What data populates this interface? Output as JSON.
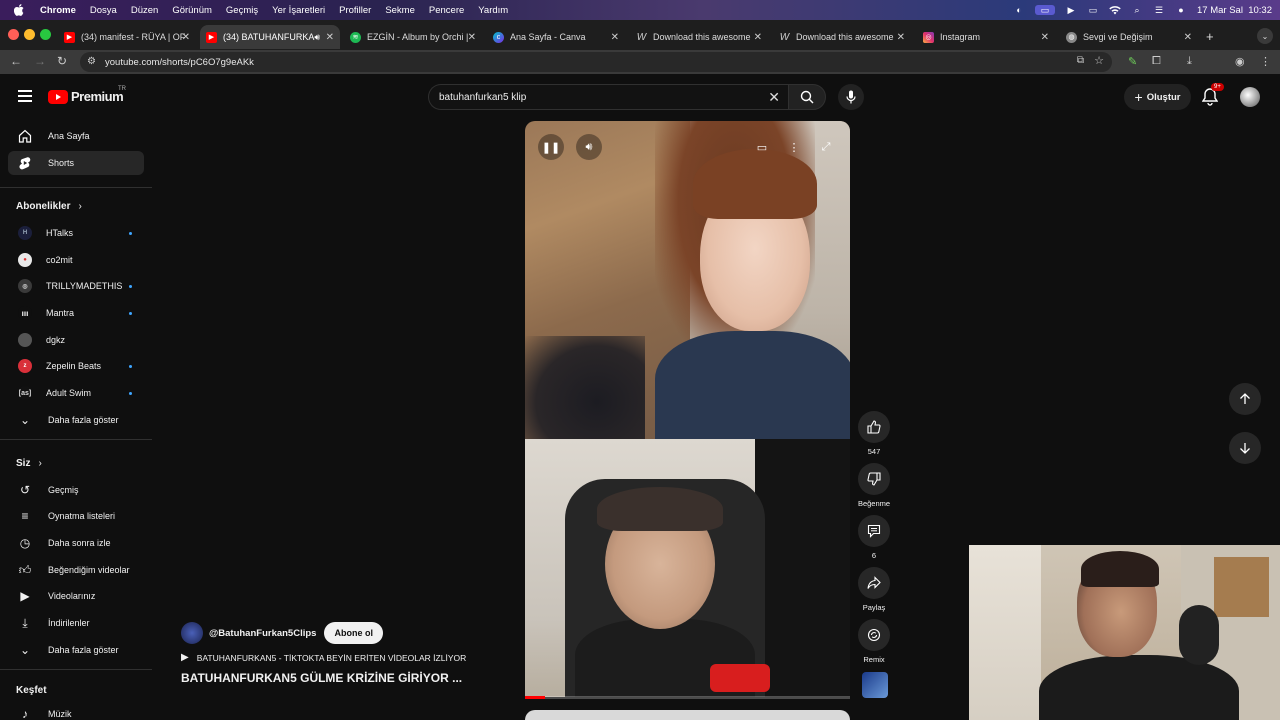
{
  "menubar": {
    "app": "Chrome",
    "items": [
      "Dosya",
      "Düzen",
      "Görünüm",
      "Geçmiş",
      "Yer İşaretleri",
      "Profiller",
      "Sekme",
      "Pencere",
      "Yardım"
    ],
    "datetime": "17 Mar Sal  10:32"
  },
  "tabs": [
    {
      "title": "(34) manifest - RÜYA | OF",
      "favicon": "youtube",
      "active": false
    },
    {
      "title": "(34) BATUHANFURKA",
      "favicon": "youtube",
      "active": true
    },
    {
      "title": "EZGİN - Album by Orchi |",
      "favicon": "spotify",
      "active": false
    },
    {
      "title": "Ana Sayfa - Canva",
      "favicon": "canva",
      "active": false
    },
    {
      "title": "Download this awesome",
      "favicon": "w-letter",
      "active": false
    },
    {
      "title": "Download this awesome",
      "favicon": "w-letter",
      "active": false
    },
    {
      "title": "Instagram",
      "favicon": "instagram",
      "active": false
    },
    {
      "title": "Sevgi ve Değişim",
      "favicon": "globe",
      "active": false
    }
  ],
  "address": {
    "url": "youtube.com/shorts/pC6O7g9eAKk"
  },
  "header": {
    "logo": "Premium",
    "region": "TR",
    "search_query": "batuhanfurkan5 klip",
    "create_label": "Oluştur",
    "notif_badge": "9+"
  },
  "sidebar": {
    "main": [
      {
        "label": "Ana Sayfa",
        "icon": "home-icon"
      },
      {
        "label": "Shorts",
        "icon": "shorts-icon",
        "active": true
      }
    ],
    "subs_title": "Abonelikler",
    "subs": [
      {
        "label": "HTalks",
        "dot": true,
        "color": "#1b1f3b"
      },
      {
        "label": "co2mit",
        "dot": false,
        "color": "#e8e8e8"
      },
      {
        "label": "TRILLYMADETHIS",
        "dot": true,
        "color": "#3a3a3a"
      },
      {
        "label": "Mantra",
        "dot": true,
        "color": "#0f0f0f"
      },
      {
        "label": "dgkz",
        "dot": false,
        "color": "#555555"
      },
      {
        "label": "Zepelin Beats",
        "dot": true,
        "color": "#d9303a"
      },
      {
        "label": "Adult Swim",
        "dot": true,
        "color": "#111111"
      }
    ],
    "more_subs": "Daha fazla göster",
    "you_title": "Siz",
    "you": [
      {
        "label": "Geçmiş",
        "icon": "history-icon"
      },
      {
        "label": "Oynatma listeleri",
        "icon": "playlist-icon"
      },
      {
        "label": "Daha sonra izle",
        "icon": "clock-icon"
      },
      {
        "label": "Beğendiğim videolar",
        "icon": "thumbs-up-icon"
      },
      {
        "label": "Videolarınız",
        "icon": "video-icon"
      },
      {
        "label": "İndirilenler",
        "icon": "download-icon"
      }
    ],
    "more_you": "Daha fazla göster",
    "explore_title": "Keşfet",
    "explore": [
      {
        "label": "Müzik",
        "icon": "music-icon"
      }
    ]
  },
  "short": {
    "likes": "547",
    "dislike_label": "Beğenme",
    "comments": "6",
    "share_label": "Paylaş",
    "remix_label": "Remix",
    "channel": "@BatuhanFurkan5Clips",
    "subscribe_label": "Abone ol",
    "music": "BATUHANFURKAN5 - TİKTOKTA BEYİN ERİTEN VİDEOLAR İZLİYOR",
    "title": "BATUHANFURKAN5 GÜLME KRİZİNE GİRİYOR ...",
    "progress": 0.06
  },
  "colors": {
    "accent": "#ff0000",
    "background": "#0f0f0f",
    "subscription_dot": "#3ea6ff"
  }
}
